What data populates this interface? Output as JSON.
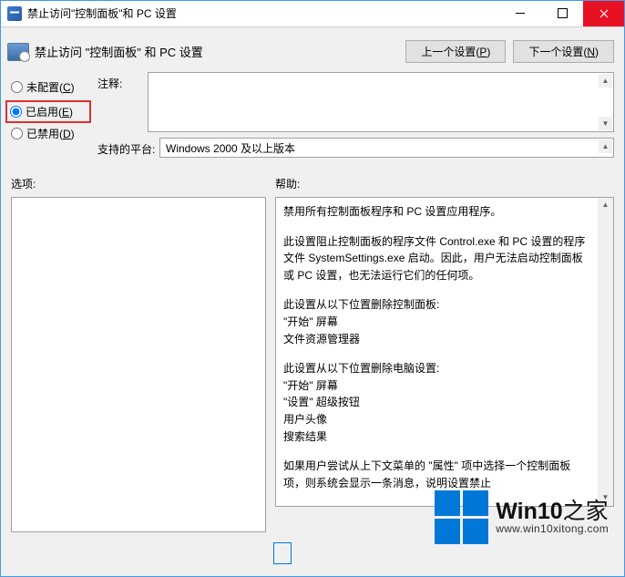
{
  "window": {
    "title": "禁止访问\"控制面板\"和 PC 设置"
  },
  "header": {
    "title": "禁止访问 \"控制面板\" 和 PC 设置",
    "prev_button": "上一个设置(P)",
    "prev_key": "P",
    "next_button": "下一个设置(N)",
    "next_key": "N"
  },
  "radio": {
    "not_configured": "未配置(C)",
    "enabled": "已启用(E)",
    "disabled": "已禁用(D)",
    "selected": "enabled"
  },
  "comment": {
    "label": "注释:",
    "value": ""
  },
  "platform": {
    "label": "支持的平台:",
    "value": "Windows 2000 及以上版本"
  },
  "options": {
    "label": "选项:"
  },
  "help": {
    "label": "帮助:",
    "paragraphs": [
      "禁用所有控制面板程序和 PC 设置应用程序。",
      "此设置阻止控制面板的程序文件 Control.exe 和 PC 设置的程序文件 SystemSettings.exe 启动。因此，用户无法启动控制面板或 PC 设置，也无法运行它们的任何项。",
      "此设置从以下位置删除控制面板:",
      "\"开始\" 屏幕",
      "文件资源管理器",
      "",
      "此设置从以下位置删除电脑设置:",
      "\"开始\" 屏幕",
      "\"设置\" 超级按钮",
      "用户头像",
      "搜索结果",
      "",
      "如果用户尝试从上下文菜单的 \"属性\" 项中选择一个控制面板项，则系统会显示一条消息，说明设置禁止"
    ]
  },
  "watermark": {
    "brand_prefix": "Win10",
    "brand_suffix": "之家",
    "url": "www.win10xitong.com"
  }
}
